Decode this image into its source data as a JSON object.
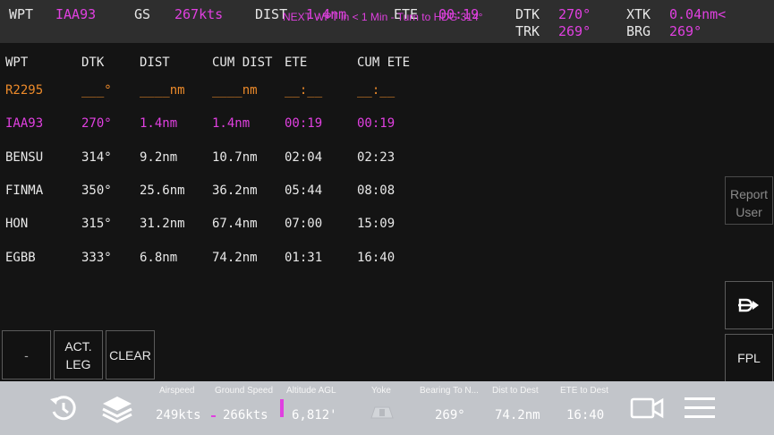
{
  "top": {
    "wpt_label": "WPT",
    "wpt_value": "IAA93",
    "gs_label": "GS",
    "gs_value": "267kts",
    "dist_label": "DIST",
    "dist_value": "1.4nm",
    "ete_label": "ETE",
    "ete_value": "00:19",
    "alert": "NEXT WPT in < 1 Min - Turn to HDG 314°",
    "dtk_label": "DTK",
    "dtk_value": "270°",
    "trk_label": "TRK",
    "trk_value": "269°",
    "xtk_label": "XTK",
    "xtk_value": "0.04nm<",
    "brg_label": "BRG",
    "brg_value": "269°"
  },
  "table": {
    "headers": [
      "WPT",
      "DTK",
      "DIST",
      "CUM DIST",
      "ETE",
      "CUM ETE"
    ],
    "rows": [
      [
        "R2295",
        "___°",
        "____nm",
        "____nm",
        "__:__",
        "__:__"
      ],
      [
        "IAA93",
        "270°",
        "1.4nm",
        "1.4nm",
        "00:19",
        "00:19"
      ],
      [
        "BENSU",
        "314°",
        "9.2nm",
        "10.7nm",
        "02:04",
        "02:23"
      ],
      [
        "FINMA",
        "350°",
        "25.6nm",
        "36.2nm",
        "05:44",
        "08:08"
      ],
      [
        "HON",
        "315°",
        "31.2nm",
        "67.4nm",
        "07:00",
        "15:09"
      ],
      [
        "EGBB",
        "333°",
        "6.8nm",
        "74.2nm",
        "01:31",
        "16:40"
      ]
    ]
  },
  "buttons": {
    "report_user_line1": "Report",
    "report_user_line2": "User",
    "direct_to_icon": "direct-to-icon",
    "fpl": "FPL",
    "dash": "-",
    "act_leg_line1": "ACT.",
    "act_leg_line2": "LEG",
    "clear": "CLEAR"
  },
  "bottom": {
    "airspeed_label": "Airspeed",
    "airspeed_value": "249kts",
    "groundspeed_label": "Ground Speed",
    "groundspeed_value": "266kts",
    "altitude_label": "Altitude AGL",
    "altitude_value": "6,812'",
    "yoke_label": "Yoke",
    "bearing_label": "Bearing To N...",
    "bearing_value": "269°",
    "dist_dest_label": "Dist to Dest",
    "dist_dest_value": "74.2nm",
    "ete_dest_label": "ETE to Dest",
    "ete_dest_value": "16:40"
  },
  "colors": {
    "magenta": "#e040e0",
    "orange": "#ec8a2a",
    "yellow": "#e8c21a",
    "topbar": "#2e2e2e",
    "bottombar": "#c2c5ca",
    "background": "#141414"
  }
}
